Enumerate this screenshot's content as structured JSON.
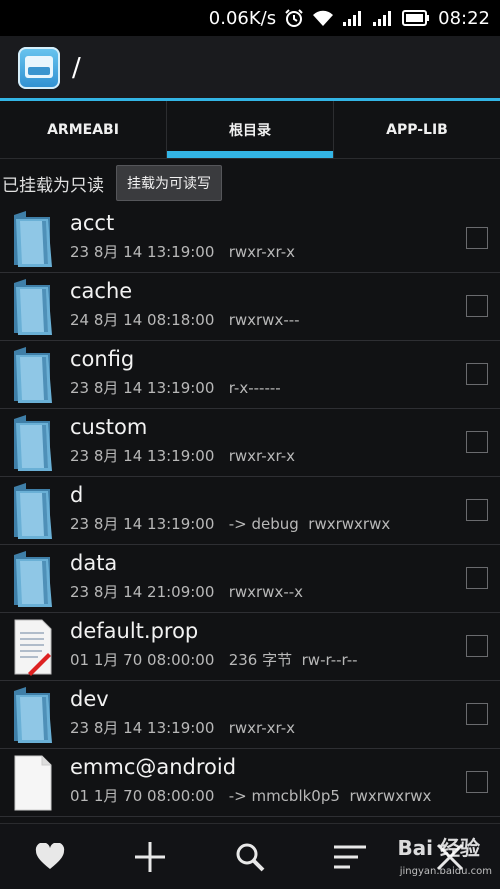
{
  "status_bar": {
    "speed": "0.06K/s",
    "icons": [
      "alarm-icon",
      "wifi-icon",
      "signal-icon",
      "signal-icon",
      "battery-icon"
    ],
    "time": "08:22"
  },
  "title_bar": {
    "app_icon": "file-manager-icon",
    "path": "/"
  },
  "tabs": [
    {
      "label": "ARMEABI",
      "active": false
    },
    {
      "label": "根目录",
      "active": true
    },
    {
      "label": "APP-LIB",
      "active": false
    }
  ],
  "mount": {
    "status": "已挂载为只读",
    "button_label": "挂载为可读写"
  },
  "files": [
    {
      "name": "acct",
      "date": "23 8月 14 13:19:00",
      "perms": "rwxr-xr-x",
      "type": "folder"
    },
    {
      "name": "cache",
      "date": "24 8月 14 08:18:00",
      "perms": "rwxrwx---",
      "type": "folder"
    },
    {
      "name": "config",
      "date": "23 8月 14 13:19:00",
      "perms": "r-x------",
      "type": "folder"
    },
    {
      "name": "custom",
      "date": "23 8月 14 13:19:00",
      "perms": "rwxr-xr-x",
      "type": "folder"
    },
    {
      "name": "d",
      "date": "23 8月 14 13:19:00",
      "perms": "-> debug  rwxrwxrwx",
      "type": "folder"
    },
    {
      "name": "data",
      "date": "23 8月 14 21:09:00",
      "perms": "rwxrwx--x",
      "type": "folder"
    },
    {
      "name": "default.prop",
      "date": "01 1月 70 08:00:00",
      "perms": "236 字节  rw-r--r--",
      "type": "text-file"
    },
    {
      "name": "dev",
      "date": "23 8月 14 13:19:00",
      "perms": "rwxr-xr-x",
      "type": "folder"
    },
    {
      "name": "emmc@android",
      "date": "01 1月 70 08:00:00",
      "perms": "-> mmcblk0p5  rwxrwxrwx",
      "type": "blank-file"
    }
  ],
  "toolbar": {
    "items": [
      "favorite-icon",
      "add-icon",
      "search-icon",
      "sort-icon",
      "close-icon"
    ]
  },
  "watermark": {
    "main": "Bai 经验",
    "sub": "jingyan.baidu.com"
  },
  "colors": {
    "accent": "#33b5e5",
    "background": "#111214"
  }
}
